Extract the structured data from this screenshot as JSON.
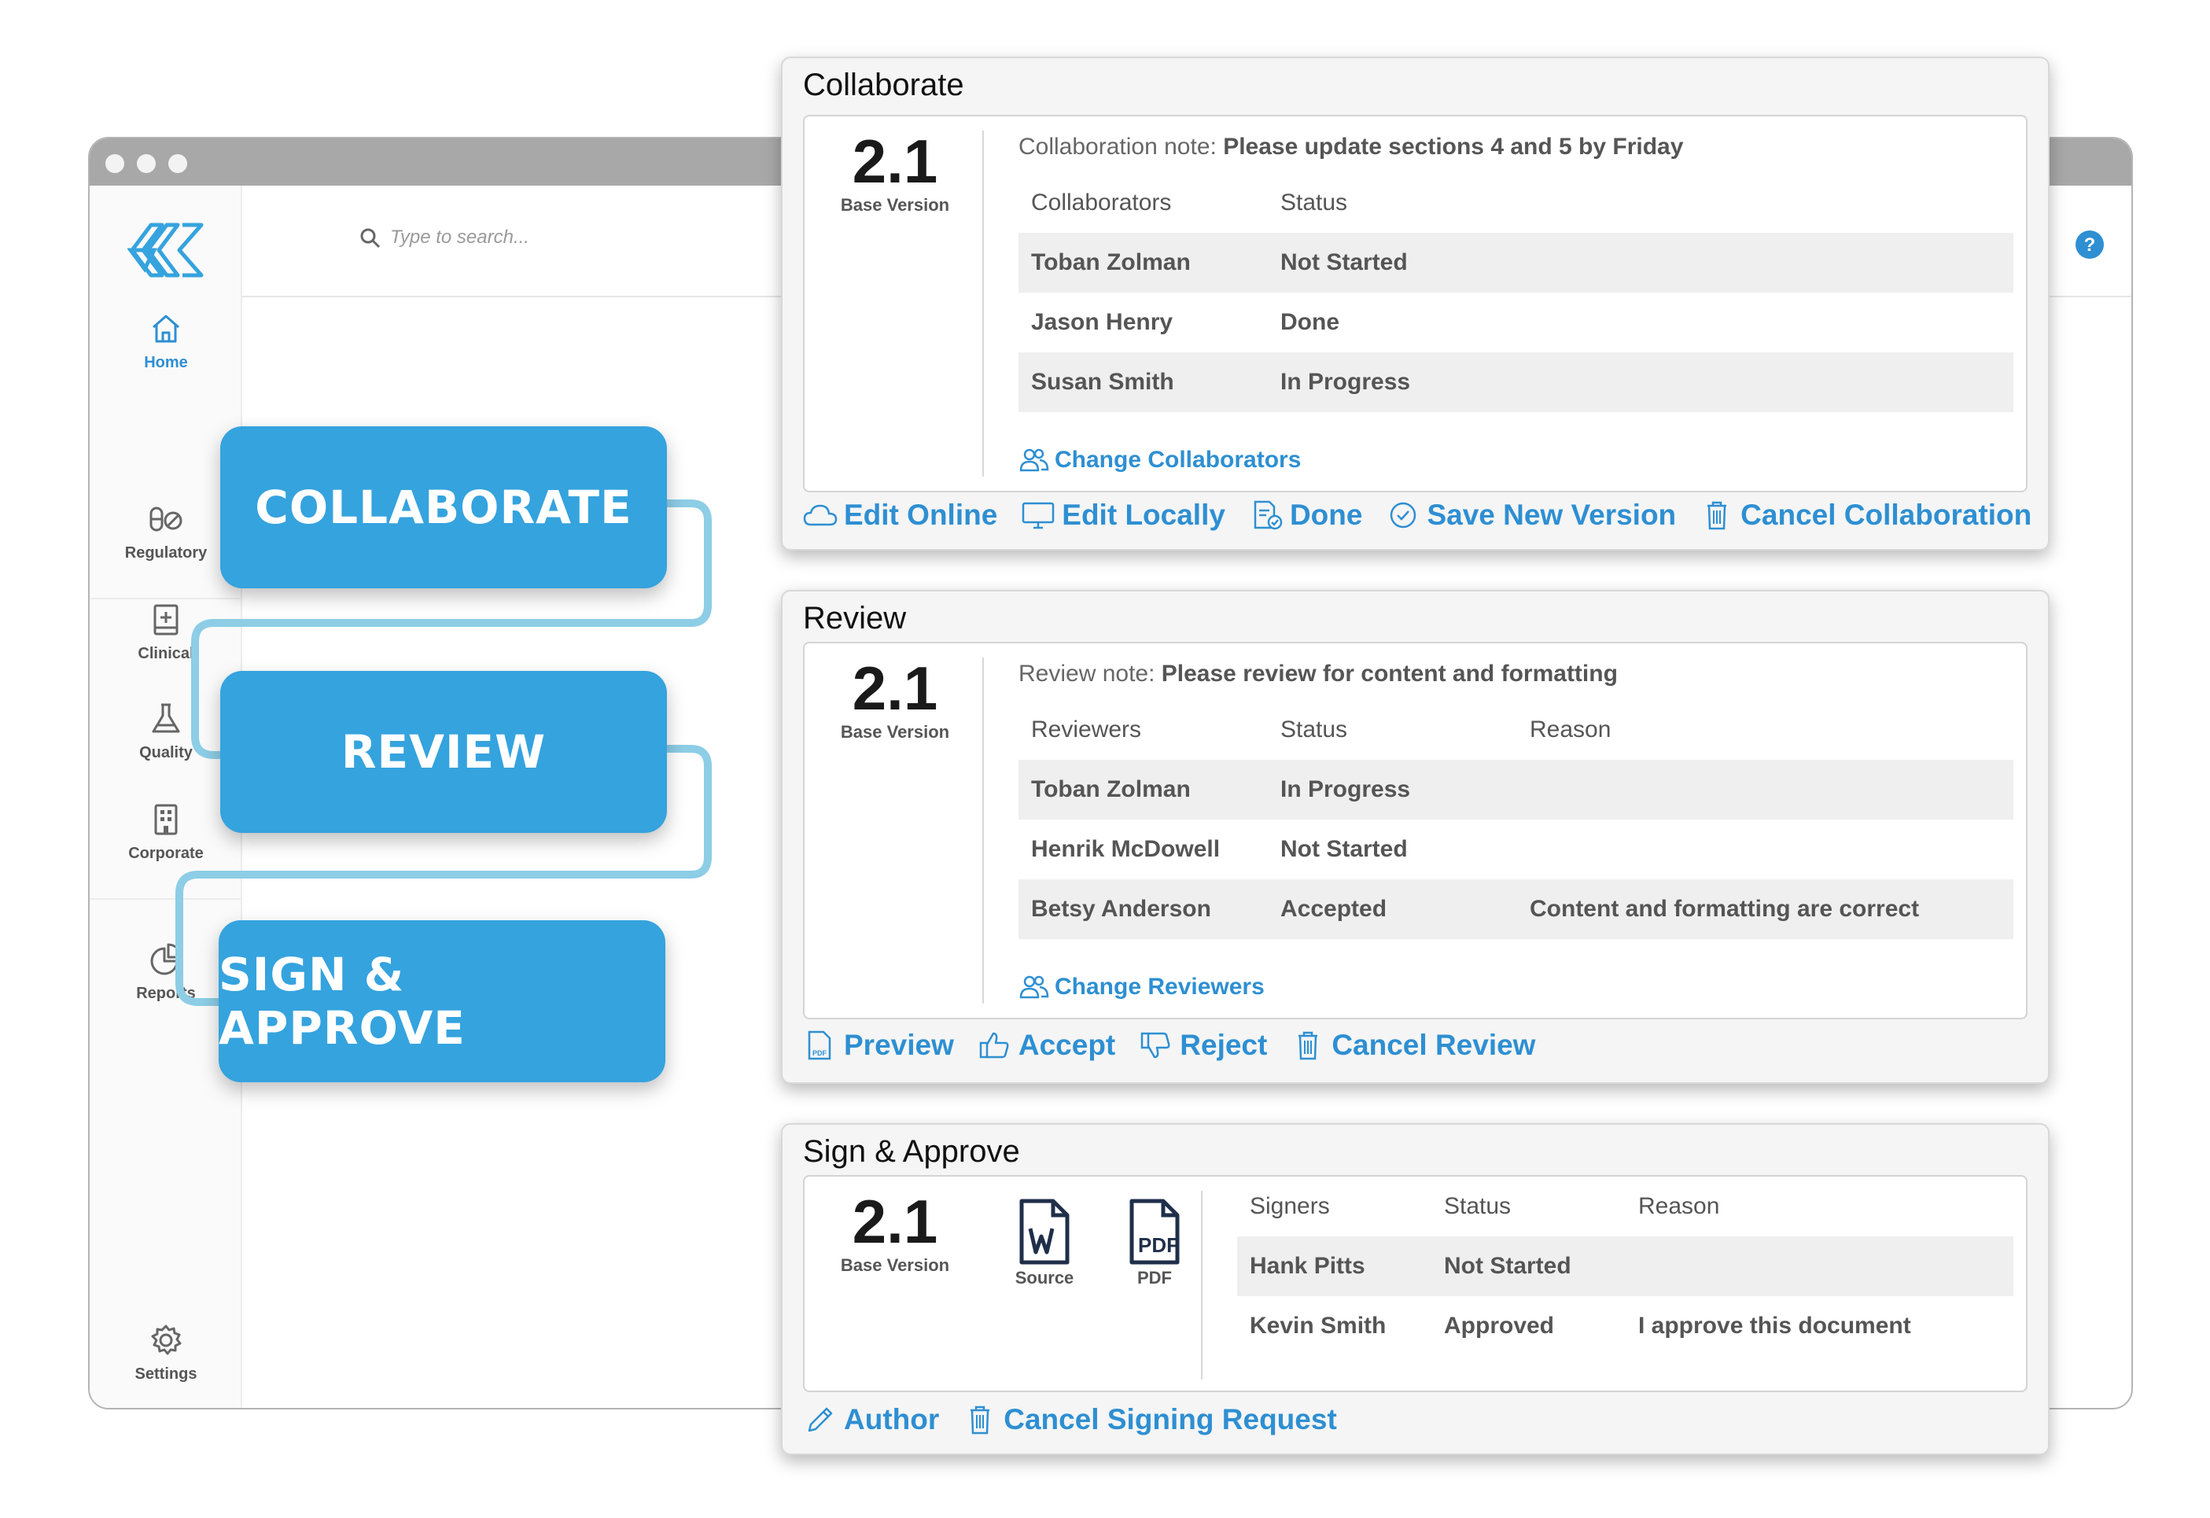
{
  "app": {
    "search_placeholder": "Type to search...",
    "nav": [
      {
        "label": "Home",
        "icon": "home-icon",
        "active": true
      },
      {
        "label": "Regulatory",
        "icon": "pills-icon"
      },
      {
        "label": "Clinical",
        "icon": "medical-book-icon"
      },
      {
        "label": "Quality",
        "icon": "flask-icon"
      },
      {
        "label": "Corporate",
        "icon": "building-icon"
      },
      {
        "label": "Reports",
        "icon": "pie-chart-icon"
      },
      {
        "label": "Settings",
        "icon": "gear-icon"
      }
    ]
  },
  "steps": [
    "COLLABORATE",
    "REVIEW",
    "SIGN & APPROVE"
  ],
  "collaborate": {
    "title": "Collaborate",
    "version": "2.1",
    "version_label": "Base Version",
    "note_label": "Collaboration note:",
    "note": "Please update sections 4 and 5 by Friday",
    "columns": [
      "Collaborators",
      "Status"
    ],
    "rows": [
      {
        "name": "Toban Zolman",
        "status": "Not Started"
      },
      {
        "name": "Jason Henry",
        "status": "Done"
      },
      {
        "name": "Susan Smith",
        "status": "In Progress"
      }
    ],
    "change_link": "Change Collaborators",
    "actions": [
      "Edit Online",
      "Edit Locally",
      "Done",
      "Save New Version",
      "Cancel Collaboration"
    ]
  },
  "review": {
    "title": "Review",
    "version": "2.1",
    "version_label": "Base Version",
    "note_label": "Review note:",
    "note": "Please review for content and formatting",
    "columns": [
      "Reviewers",
      "Status",
      "Reason"
    ],
    "rows": [
      {
        "name": "Toban Zolman",
        "status": "In Progress",
        "reason": ""
      },
      {
        "name": "Henrik McDowell",
        "status": "Not Started",
        "reason": ""
      },
      {
        "name": "Betsy Anderson",
        "status": "Accepted",
        "reason": "Content and formatting are correct"
      }
    ],
    "change_link": "Change Reviewers",
    "actions": [
      "Preview",
      "Accept",
      "Reject",
      "Cancel Review"
    ]
  },
  "sign": {
    "title": "Sign & Approve",
    "version": "2.1",
    "version_label": "Base Version",
    "source_label": "Source",
    "pdf_label": "PDF",
    "columns": [
      "Signers",
      "Status",
      "Reason"
    ],
    "rows": [
      {
        "name": "Hank Pitts",
        "status": "Not Started",
        "reason": ""
      },
      {
        "name": "Kevin Smith",
        "status": "Approved",
        "reason": "I approve this document"
      }
    ],
    "actions": [
      "Author",
      "Cancel Signing Request"
    ]
  },
  "colors": {
    "accent": "#35a3de",
    "link": "#2e8fd2",
    "connector": "#8dcde6"
  }
}
